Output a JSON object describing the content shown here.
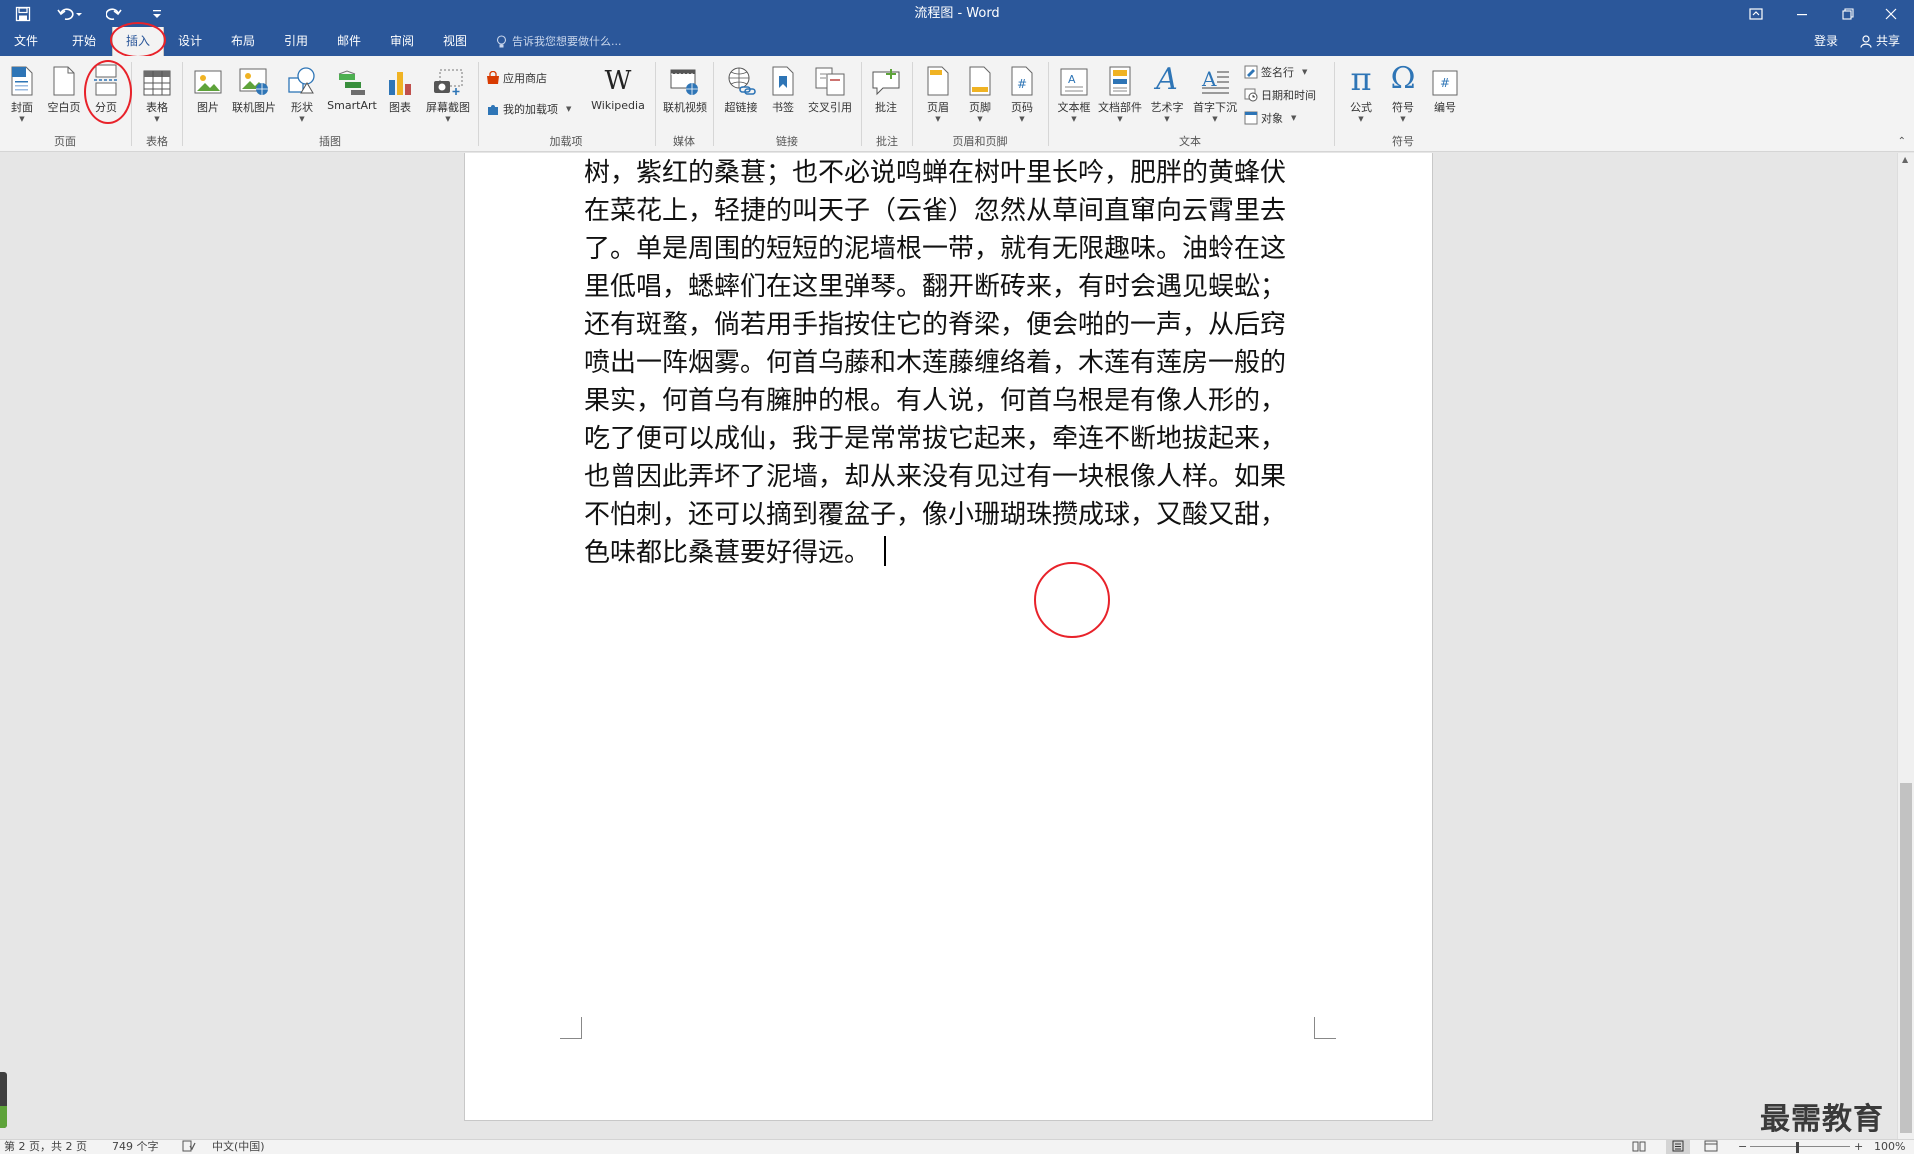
{
  "title_bar": {
    "title": "流程图 - Word"
  },
  "tabs": [
    {
      "label": "文件"
    },
    {
      "label": "开始"
    },
    {
      "label": "插入",
      "active": true
    },
    {
      "label": "设计"
    },
    {
      "label": "布局"
    },
    {
      "label": "引用"
    },
    {
      "label": "邮件"
    },
    {
      "label": "审阅"
    },
    {
      "label": "视图"
    }
  ],
  "tell_me": {
    "placeholder": "告诉我您想要做什么..."
  },
  "account": {
    "login": "登录",
    "share": "共享"
  },
  "ribbon": {
    "groups": {
      "pages": "页面",
      "tables": "表格",
      "illustrations": "插图",
      "addins": "加载项",
      "media": "媒体",
      "links": "链接",
      "comments": "批注",
      "header_footer": "页眉和页脚",
      "text": "文本",
      "symbols": "符号"
    },
    "buttons": {
      "cover": "封面",
      "blank_page": "空白页",
      "page_break": "分页",
      "table": "表格",
      "picture": "图片",
      "online_picture": "联机图片",
      "shapes": "形状",
      "smartart": "SmartArt",
      "chart": "图表",
      "screenshot": "屏幕截图",
      "store": "应用商店",
      "my_addins": "我的加载项",
      "wikipedia": "Wikipedia",
      "online_video": "联机视频",
      "hyperlink": "超链接",
      "bookmark": "书签",
      "cross_reference": "交叉引用",
      "comment": "批注",
      "header": "页眉",
      "footer": "页脚",
      "page_number": "页码",
      "text_box": "文本框",
      "quick_parts": "文档部件",
      "wordart": "艺术字",
      "drop_cap": "首字下沉",
      "signature_line": "签名行",
      "date_time": "日期和时间",
      "object": "对象",
      "equation": "公式",
      "symbol": "符号",
      "number": "编号"
    }
  },
  "document": {
    "text": "树，紫红的桑葚；也不必说鸣蝉在树叶里长吟，肥胖的黄蜂伏在菜花上，轻捷的叫天子（云雀）忽然从草间直窜向云霄里去了。单是周围的短短的泥墙根一带，就有无限趣味。油蛉在这里低唱，蟋蟀们在这里弹琴。翻开断砖来，有时会遇见蜈蚣；还有斑蝥，倘若用手指按住它的脊梁，便会啪的一声，从后窍喷出一阵烟雾。何首乌藤和木莲藤缠络着，木莲有莲房一般的果实，何首乌有臃肿的根。有人说，何首乌根是有像人形的，吃了便可以成仙，我于是常常拔它起来，牵连不断地拔起来，也曾因此弄坏了泥墙，却从来没有见过有一块根像人样。如果不怕刺，还可以摘到覆盆子，像小珊瑚珠攒成球，又酸又甜，色味都比桑葚要好得远。"
  },
  "status_bar": {
    "page": "第 2 页，共 2 页",
    "words": "749 个字",
    "language": "中文(中国)",
    "zoom": "100%"
  },
  "watermark": {
    "text": "最需教育"
  },
  "colors": {
    "brand": "#2b579a",
    "annotation": "#e8222a"
  }
}
